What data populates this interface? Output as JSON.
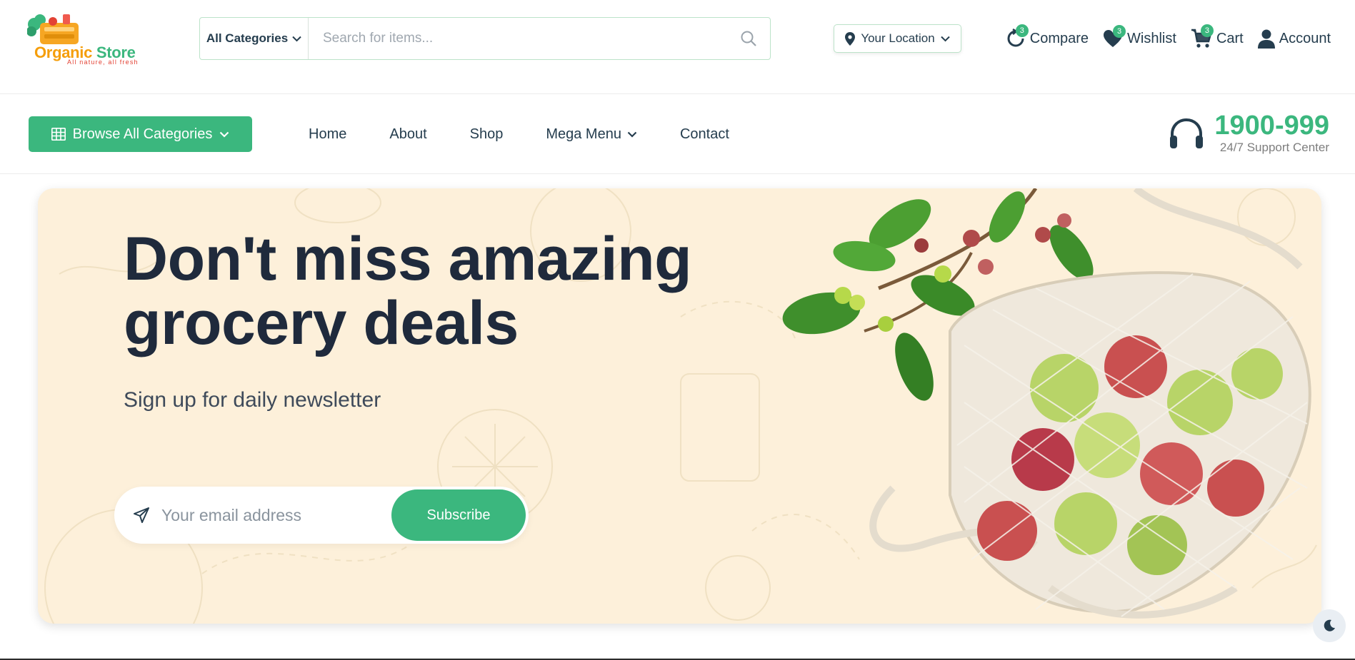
{
  "brand": {
    "name_part1": "Organic",
    "name_part2": " Store",
    "tagline": "All nature, all fresh",
    "accent_color": "#3bb77e"
  },
  "search": {
    "category_label": "All Categories",
    "placeholder": "Search for items...",
    "value": ""
  },
  "location": {
    "label": "Your Location"
  },
  "actions": {
    "compare": {
      "label": "Compare",
      "count": "3"
    },
    "wishlist": {
      "label": "Wishlist",
      "count": "3"
    },
    "cart": {
      "label": "Cart",
      "count": "3"
    },
    "account": {
      "label": "Account"
    }
  },
  "nav": {
    "browse_label": "Browse All Categories",
    "links": [
      {
        "label": "Home"
      },
      {
        "label": "About"
      },
      {
        "label": "Shop"
      },
      {
        "label": "Mega Menu"
      },
      {
        "label": "Contact"
      }
    ]
  },
  "support": {
    "phone": "1900-999",
    "subtitle": "24/7 Support Center"
  },
  "hero": {
    "title_line1": "Don't miss amazing",
    "title_line2": "grocery deals",
    "subtitle": "Sign up for daily newsletter",
    "email_placeholder": "Your email address",
    "email_value": "",
    "subscribe_label": "Subscribe",
    "background_color": "#fdf0da"
  },
  "icons": {
    "location": "map-pin-icon",
    "compare": "refresh-icon",
    "wishlist": "heart-icon",
    "cart": "cart-icon",
    "account": "user-icon",
    "support": "headphones-icon",
    "send": "paper-plane-icon",
    "theme": "moon-icon"
  }
}
